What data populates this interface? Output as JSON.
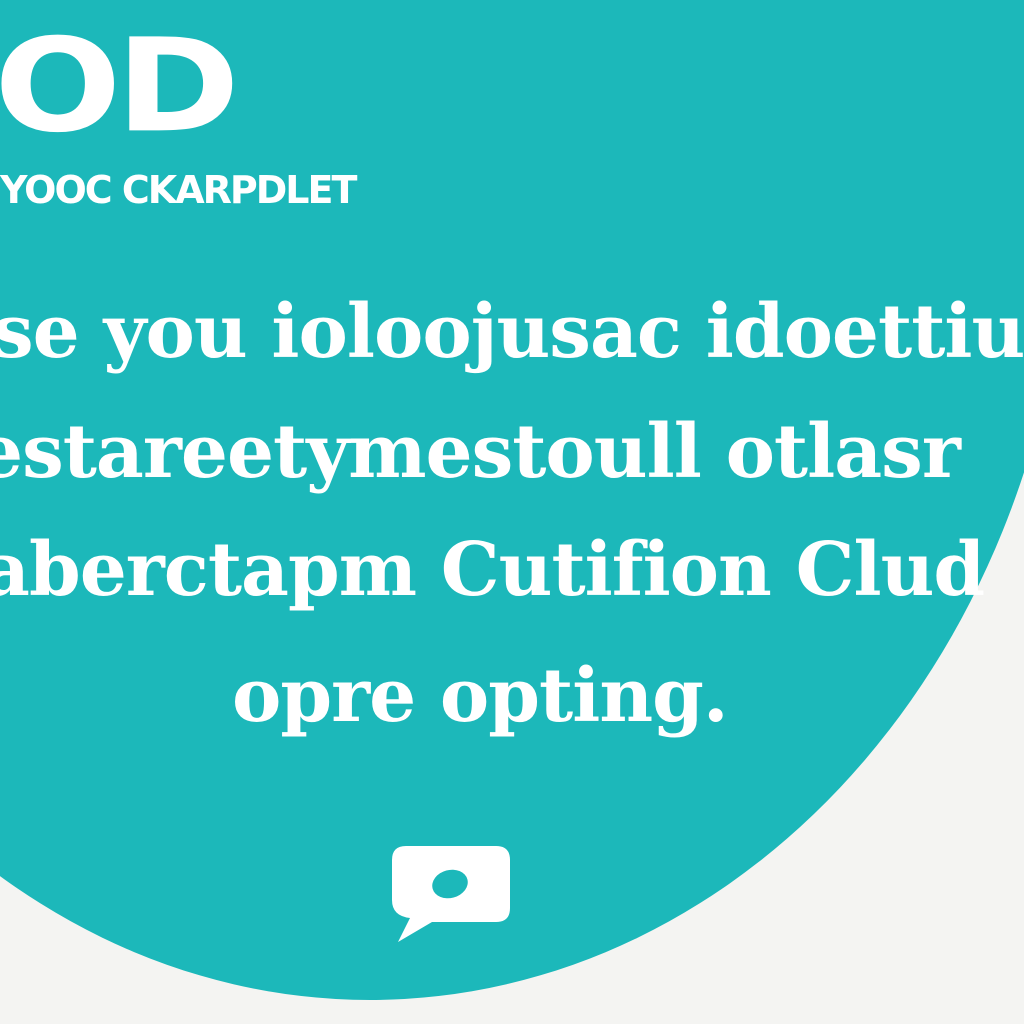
{
  "logo": {
    "text": "OD"
  },
  "tagline": {
    "text": "YOOC CKARPDLET"
  },
  "body": {
    "lines": [
      "se you ioloojusac idoettius",
      "estareetymestoull otlasr",
      "aberctapm Cutifion Clud",
      "opre opting."
    ]
  },
  "icons": {
    "chat": "speech-bubble-icon"
  },
  "colors": {
    "teal": "#1cb8ba",
    "white": "#ffffff",
    "background": "#f4f4f2"
  }
}
